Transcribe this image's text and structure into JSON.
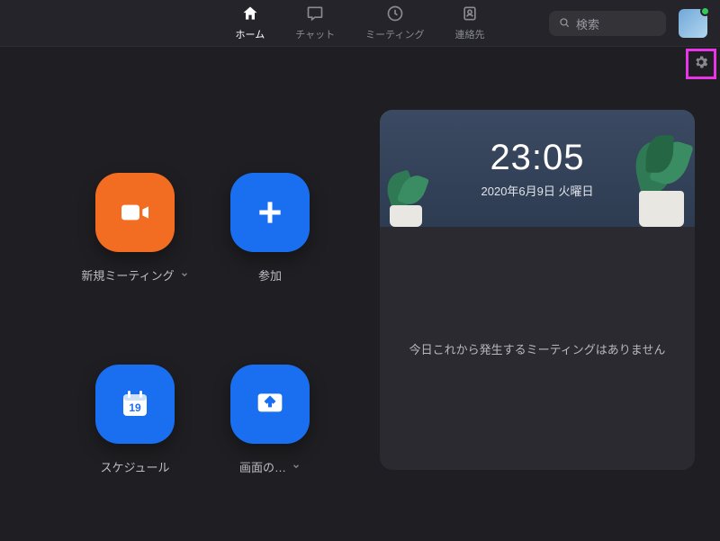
{
  "nav": {
    "home": "ホーム",
    "chat": "チャット",
    "meetings": "ミーティング",
    "contacts": "連絡先"
  },
  "search": {
    "placeholder": "検索"
  },
  "actions": {
    "new_meeting": "新規ミーティング",
    "join": "参加",
    "schedule": "スケジュール",
    "share": "画面の…"
  },
  "calendar_day": "19",
  "panel": {
    "time": "23:05",
    "date": "2020年6月9日 火曜日",
    "empty": "今日これから発生するミーティングはありません"
  }
}
